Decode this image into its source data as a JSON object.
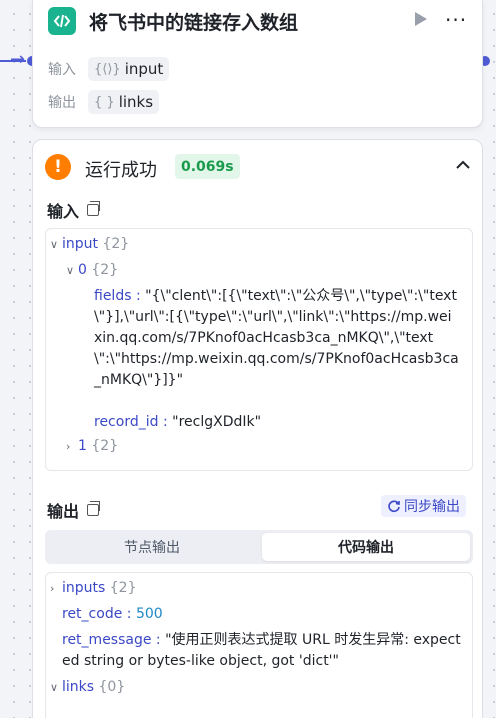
{
  "node": {
    "title": "将飞书中的链接存入数组",
    "input_label": "输入",
    "input_value": "input",
    "input_glyph": "{⟨⟩}",
    "output_label": "输出",
    "output_value": "links",
    "output_glyph": "{ }"
  },
  "result": {
    "status": "运行成功",
    "time": "0.069s",
    "input_title": "输入",
    "output_title": "输出",
    "sync_label": "同步输出",
    "tabs": [
      "节点输出",
      "代码输出"
    ],
    "input_tree": {
      "root_key": "input",
      "root_count": "{2}",
      "item0_key": "0",
      "item0_count": "{2}",
      "fields_key": "fields",
      "fields_value": "\"{\\\"clent\\\":[{\\\"text\\\":\\\"公众号\\\",\\\"type\\\":\\\"text\\\"}],\\\"url\\\":[{\\\"type\\\":\\\"url\\\",\\\"link\\\":\\\"https://mp.weixin.qq.com/s/7PKnof0acHcasb3ca_nMKQ\\\",\\\"text\\\":\\\"https://mp.weixin.qq.com/s/7PKnof0acHcasb3ca_nMKQ\\\"}]}\"",
      "record_key": "record_id",
      "record_value": "\"reclgXDdIk\"",
      "item1_key": "1",
      "item1_count": "{2}"
    },
    "output_tree": {
      "inputs_key": "inputs",
      "inputs_count": "{2}",
      "ret_code_key": "ret_code",
      "ret_code_value": "500",
      "ret_message_key": "ret_message",
      "ret_message_value": "\"使用正则表达式提取 URL 时发生异常: expected string or bytes-like object, got 'dict'\"",
      "links_key": "links",
      "links_count": "{0}"
    }
  },
  "colors": {
    "accent": "#4f5bd5",
    "node_icon": "#19b38f",
    "status_warning": "#ff7d00",
    "success_badge": "#1a9b4b"
  }
}
